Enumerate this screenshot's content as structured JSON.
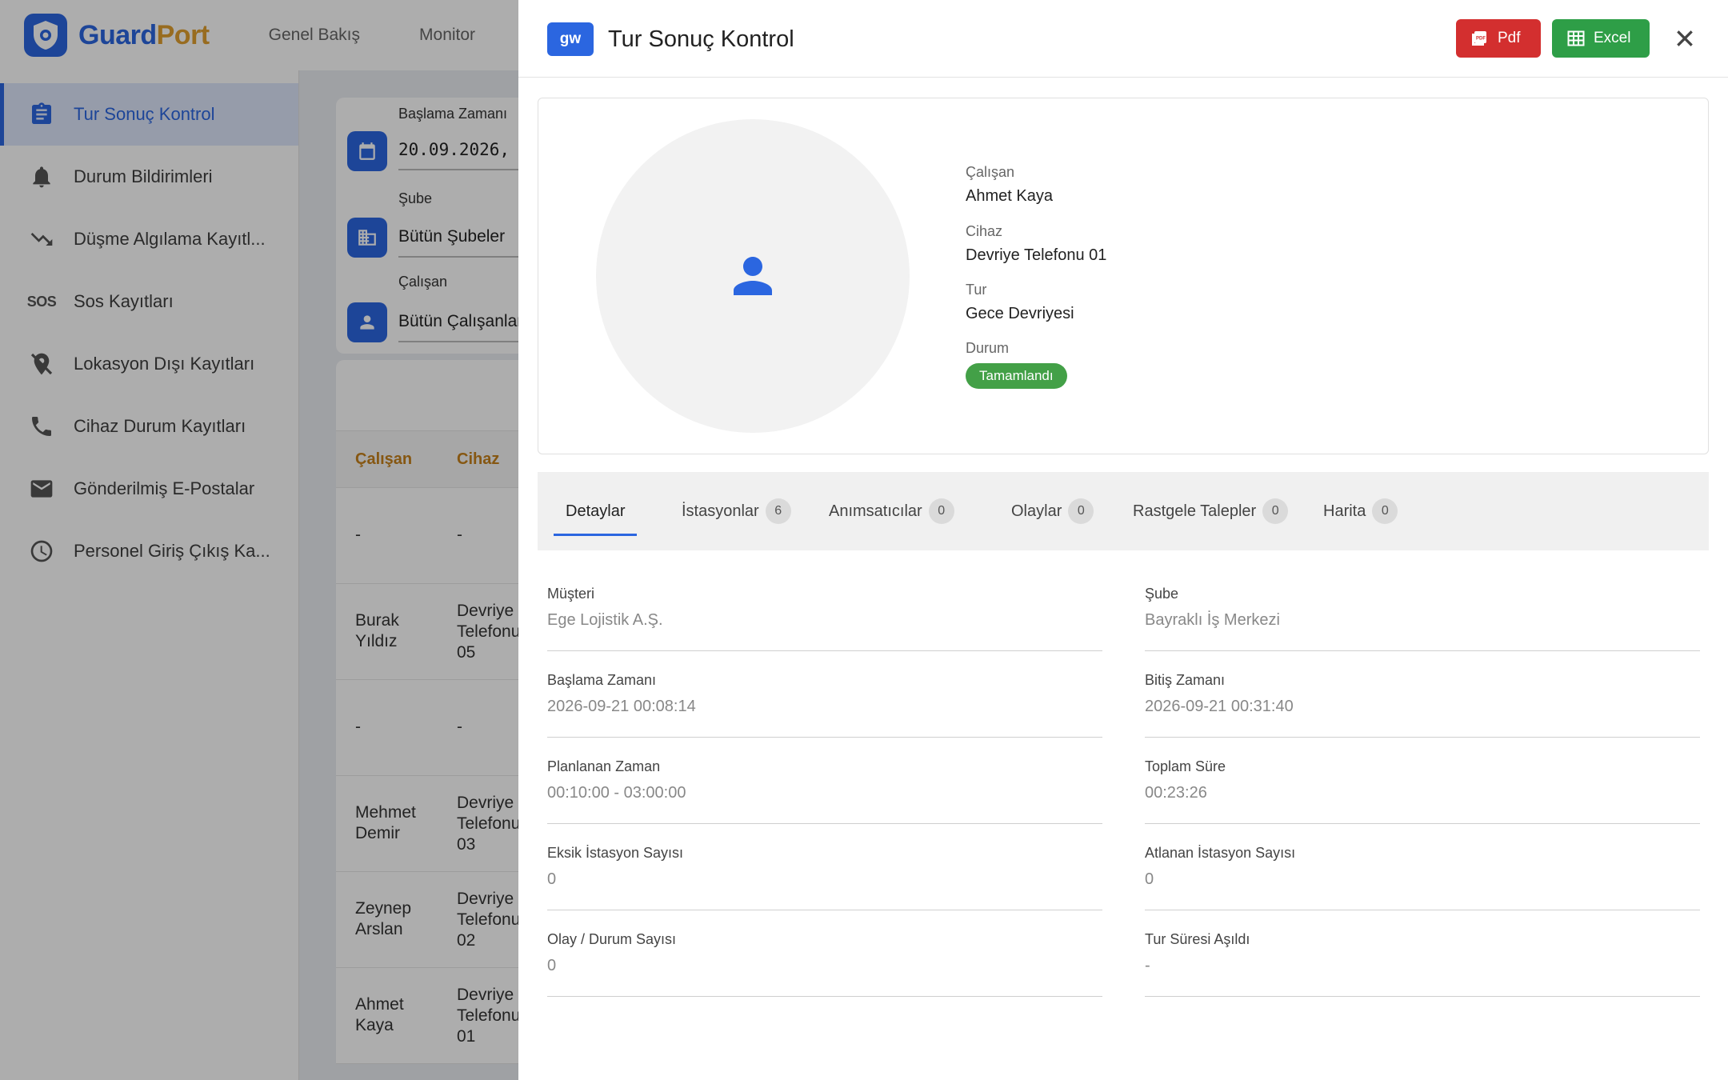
{
  "brand": {
    "name_part1": "Guard",
    "name_part2": "Port",
    "accent": "#2b66e0",
    "accent2": "#e0a030"
  },
  "topnav": [
    "Genel Bakış",
    "Monitor"
  ],
  "sidebar": {
    "items": [
      {
        "label": "Tur Sonuç Kontrol",
        "icon": "clipboard-icon",
        "active": true
      },
      {
        "label": "Durum Bildirimleri",
        "icon": "bell-icon"
      },
      {
        "label": "Düşme Algılama Kayıtl...",
        "icon": "trending-down-icon"
      },
      {
        "label": "Sos Kayıtları",
        "icon": "sos-icon",
        "icon_text": "SOS"
      },
      {
        "label": "Lokasyon Dışı Kayıtları",
        "icon": "location-off-icon"
      },
      {
        "label": "Cihaz Durum Kayıtları",
        "icon": "phone-icon"
      },
      {
        "label": "Gönderilmiş E-Postalar",
        "icon": "mail-icon"
      },
      {
        "label": "Personel Giriş Çıkış Ka...",
        "icon": "clock-icon"
      }
    ]
  },
  "filters": {
    "start_label": "Başlama Zamanı",
    "start_value": "20.09.2026,",
    "branch_label": "Şube",
    "branch_value": "Bütün Şubeler",
    "employee_label": "Çalışan",
    "employee_value": "Bütün Çalışanlar"
  },
  "table": {
    "columns": [
      "Çalışan",
      "Cihaz"
    ],
    "rows": [
      {
        "employee": [
          "-"
        ],
        "device": [
          "-"
        ]
      },
      {
        "employee": [
          "Burak",
          "Yıldız"
        ],
        "device": [
          "Devriye",
          "Telefonu",
          "05"
        ]
      },
      {
        "employee": [
          "-"
        ],
        "device": [
          "-"
        ]
      },
      {
        "employee": [
          "Mehmet",
          "Demir"
        ],
        "device": [
          "Devriye",
          "Telefonu",
          "03"
        ]
      },
      {
        "employee": [
          "Zeynep",
          "Arslan"
        ],
        "device": [
          "Devriye",
          "Telefonu",
          "02"
        ]
      },
      {
        "employee": [
          "Ahmet",
          "Kaya"
        ],
        "device": [
          "Devriye",
          "Telefonu",
          "01"
        ]
      }
    ]
  },
  "drawer": {
    "badge": "gw",
    "title": "Tur Sonuç Kontrol",
    "pdf_label": "Pdf",
    "excel_label": "Excel",
    "profile": {
      "employee_label": "Çalışan",
      "employee_value": "Ahmet Kaya",
      "device_label": "Cihaz",
      "device_value": "Devriye Telefonu 01",
      "tour_label": "Tur",
      "tour_value": "Gece Devriyesi",
      "status_label": "Durum",
      "status_value": "Tamamlandı"
    },
    "tabs": [
      {
        "label": "Detaylar"
      },
      {
        "label": "İstasyonlar",
        "count": "6"
      },
      {
        "label": "Anımsatıcılar",
        "count": "0"
      },
      {
        "label": "Olaylar",
        "count": "0"
      },
      {
        "label": "Rastgele Talepler",
        "count": "0"
      },
      {
        "label": "Harita",
        "count": "0"
      }
    ],
    "details": {
      "customer_label": "Müşteri",
      "customer_value": "Ege Lojistik A.Ş.",
      "branch_label": "Şube",
      "branch_value": "Bayraklı İş Merkezi",
      "start_label": "Başlama Zamanı",
      "start_value": "2026-09-21 00:08:14",
      "end_label": "Bitiş Zamanı",
      "end_value": "2026-09-21 00:31:40",
      "planned_label": "Planlanan Zaman",
      "planned_value": "00:10:00 - 03:00:00",
      "total_label": "Toplam Süre",
      "total_value": "00:23:26",
      "missing_label": "Eksik İstasyon Sayısı",
      "missing_value": "0",
      "skipped_label": "Atlanan İstasyon Sayısı",
      "skipped_value": "0",
      "events_label": "Olay / Durum Sayısı",
      "events_value": "0",
      "exceeded_label": "Tur Süresi Aşıldı",
      "exceeded_value": "-"
    }
  },
  "colors": {
    "pdf": "#d32f2f",
    "excel": "#2e9e47",
    "status_done": "#43a047",
    "column_header": "#c6811b"
  }
}
